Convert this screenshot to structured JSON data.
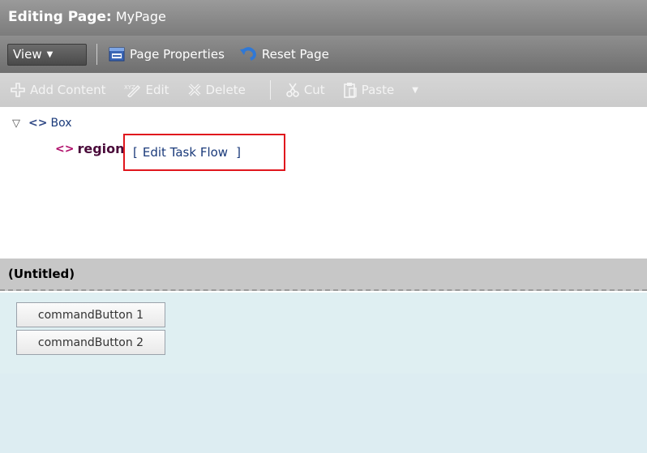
{
  "title": {
    "prefix": "Editing Page:",
    "page_name": "MyPage"
  },
  "menubar": {
    "view_label": "View",
    "page_properties_label": "Page Properties",
    "reset_page_label": "Reset Page"
  },
  "toolbar": {
    "add_content_label": "Add Content",
    "edit_label": "Edit",
    "delete_label": "Delete",
    "cut_label": "Cut",
    "paste_label": "Paste"
  },
  "tree": {
    "box_label": "Box",
    "region_label": "region",
    "open_bracket": "[",
    "edit_task_flow_label": "Edit Task Flow",
    "close_bracket": "]"
  },
  "panel": {
    "title": "(Untitled)",
    "buttons": [
      {
        "label": "commandButton 1"
      },
      {
        "label": "commandButton 2"
      }
    ]
  },
  "colors": {
    "highlight_border": "#e0161d",
    "panel_background": "#dfeff2"
  }
}
